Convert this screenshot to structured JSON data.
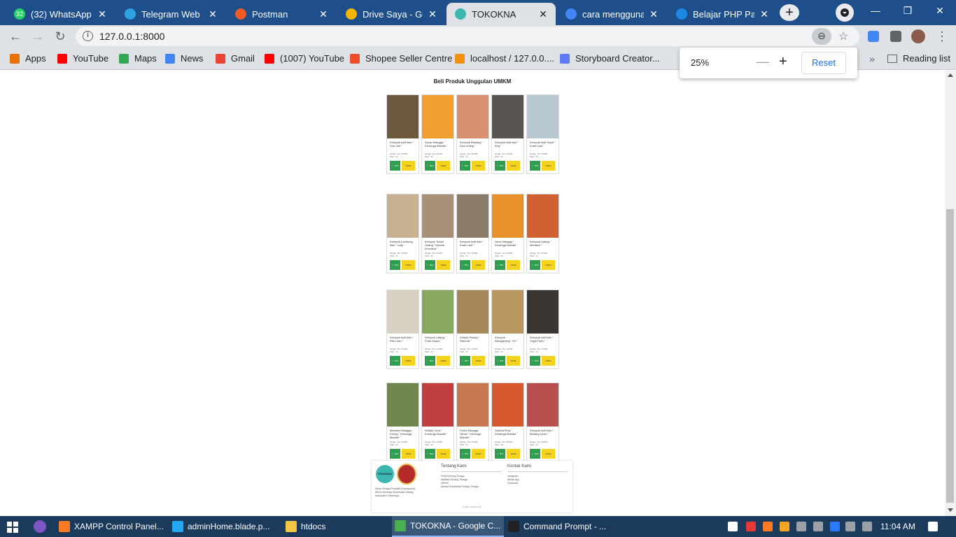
{
  "browser": {
    "tabs": [
      {
        "label": "(32) WhatsApp",
        "icon": "whatsapp-icon",
        "badge": "32",
        "color": "#25d366",
        "active": false
      },
      {
        "label": "Telegram Web",
        "icon": "telegram-icon",
        "color": "#2aa3df",
        "active": false
      },
      {
        "label": "Postman",
        "icon": "postman-icon",
        "color": "#ef5b25",
        "active": false
      },
      {
        "label": "Drive Saya - Goog",
        "icon": "drive-icon",
        "color": "#f4b400",
        "active": false
      },
      {
        "label": "TOKOKNA",
        "icon": "tokokna-icon",
        "color": "#3bb6b0",
        "active": true
      },
      {
        "label": "cara menggunaka",
        "icon": "google-icon",
        "color": "#4285f4",
        "active": false
      },
      {
        "label": "Belajar PHP Part",
        "icon": "dicoding-icon",
        "color": "#1e88e5",
        "active": false
      }
    ],
    "url": "127.0.0.1:8000",
    "bookmarks": [
      {
        "label": "Apps",
        "icon": "apps-grid-icon",
        "color": "#e8710a"
      },
      {
        "label": "YouTube",
        "icon": "youtube-icon",
        "color": "#ff0000"
      },
      {
        "label": "Maps",
        "icon": "maps-icon",
        "color": "#34a853"
      },
      {
        "label": "News",
        "icon": "news-icon",
        "color": "#4285f4"
      },
      {
        "label": "Gmail",
        "icon": "gmail-icon",
        "color": "#ea4335"
      },
      {
        "label": "(1007) YouTube",
        "icon": "youtube-icon",
        "color": "#ff0000"
      },
      {
        "label": "Shopee Seller Centre",
        "icon": "shopee-icon",
        "color": "#ee4d2d"
      },
      {
        "label": "localhost / 127.0.0....",
        "icon": "phpmyadmin-icon",
        "color": "#f29111"
      },
      {
        "label": "Storyboard Creator...",
        "icon": "storyboard-icon",
        "color": "#5c7cfa"
      }
    ],
    "reading_list": "Reading list",
    "zoom_popup": {
      "value": "25%",
      "minus": "—",
      "plus": "+",
      "reset": "Reset"
    }
  },
  "page": {
    "section_title": "Beli Produk Unggulan UMKM",
    "buy_label": "Beli",
    "detail_label": "Detail",
    "products": [
      [
        {
          "name": "Kerupuk kulit ikan \" Dua Jari \"",
          "price": "Harga : Rp. 10.000",
          "stock": "Stok : 21",
          "img": "#6d5a3e"
        },
        {
          "name": "Syrup Mangga \" Kenanga Mandiri \"",
          "price": "Harga : Rp. 25.000",
          "stock": "Stok : 21",
          "img": "#f0a030"
        },
        {
          "name": "Kerupuk Bawang \" Dua Udang \"",
          "price": "Harga : Rp. 15.000",
          "stock": "Stok : 21",
          "img": "#d89070"
        },
        {
          "name": "Kerupuk kulit ikan \" Indy \"",
          "price": "Harga : Rp. 10.000",
          "stock": "Stok : 21",
          "img": "#5a5550"
        },
        {
          "name": "Kerupuk kulit Gapit \" Kuda Laut \"",
          "price": "Harga : Rp. 10.000",
          "stock": "Stok : 26",
          "img": "#b8c8d0"
        }
      ],
      [
        {
          "name": "Kerupuk Lambung Ikan \" Indy \"",
          "price": "Harga : Rp. 10.000",
          "stock": "Stok : 21",
          "img": "#c8b090"
        },
        {
          "name": "Kerupuk Terasi Udang \" Mereta Kencana \"",
          "price": "Harga : Rp. 10.000",
          "stock": "Stok : 21",
          "img": "#a89078"
        },
        {
          "name": "Kerupuk kulit ikan \" Kuda Laut \"",
          "price": "Harga : Rp. 10.000",
          "stock": "Stok : 21",
          "img": "#8a7a68"
        },
        {
          "name": "Juice Mangga \" Kenanga Mandiri \"",
          "price": "Harga : Rp. 10.000",
          "stock": "Stok : 21",
          "img": "#e8902a"
        },
        {
          "name": "Kerupuk Udang \" Mentara \"",
          "price": "Harga : Rp. 15.000",
          "stock": "Stok : 21",
          "img": "#d06030"
        }
      ],
      [
        {
          "name": "Kerupuk kulit ikan \" Pita Laku \"",
          "price": "Harga : Rp. 10.000",
          "stock": "Stok : 21",
          "img": "#d8d0c0"
        },
        {
          "name": "Kerupuk Udang \" Putut Anjani \"",
          "price": "Harga : Rp. 10.000",
          "stock": "Stok : 21",
          "img": "#88a860"
        },
        {
          "name": "Keripik Pisang \" Rahmat \"",
          "price": "Harga : Rp. 10.000",
          "stock": "Stok : 21",
          "img": "#a88858"
        },
        {
          "name": "Kerupuk Rangginang \" Rz \"",
          "price": "Harga : Rp. 10.000",
          "stock": "Stok : 21",
          "img": "#b89860"
        },
        {
          "name": "Kerupuk kulit ikan \" Yoga Putra \"",
          "price": "Harga : Rp. 10.000",
          "stock": "Stok : 21",
          "img": "#3a3530"
        }
      ],
      [
        {
          "name": "Manisan Mangga Kering \" Kenanga Mandiri \"",
          "price": "Harga : Rp. 10.000",
          "stock": "Stok : 21",
          "img": "#708850"
        },
        {
          "name": "Keripik Usus \" Kenanga Mandiri \"",
          "price": "Harga : Rp. 10.000",
          "stock": "Stok : 21",
          "img": "#c04040"
        },
        {
          "name": "Dodol Mangga Slices \" Kenanga Mandiri \"",
          "price": "Harga : Rp. 20.000",
          "stock": "Stok : 21",
          "img": "#c87850"
        },
        {
          "name": "Sambal Roa \" Kenanga Mandiri \"",
          "price": "Harga : Rp. 25.000",
          "stock": "Stok : 29",
          "img": "#d85830"
        },
        {
          "name": "Kerupuk kulit ikan \" Bintang Ulum \"",
          "price": "Harga : Rp. 10.000",
          "stock": "Stok : 21",
          "img": "#b85050"
        }
      ]
    ],
    "footer": {
      "logo_text": "TOKOKNA",
      "desc": "Dinas Tenaga Produktif (Disnakprod) Dinas Kenanga Kecamatan Sidang Kabupaten Indramayu",
      "tentang_title": "Tentang Kami",
      "tentang_links": [
        "Profil Kenang Tenaga",
        "Aktifitas Kenang Tenaga",
        "UMKM",
        "Alamat Sekretariat Tenang Tenaga"
      ],
      "kontak_title": "Kontak Kami",
      "kontak_links": [
        "Instagram",
        "Whats App",
        "Facebook"
      ],
      "copyright": "© 2021 Tokokna Tim"
    }
  },
  "taskbar": {
    "items": [
      {
        "label": "XAMPP Control Panel...",
        "icon": "xampp-icon",
        "color": "#fb7a24"
      },
      {
        "label": "adminHome.blade.p...",
        "icon": "vscode-icon",
        "color": "#23a9f2"
      },
      {
        "label": "htdocs",
        "icon": "folder-icon",
        "color": "#f6c744"
      },
      {
        "label": "TOKOKNA - Google C...",
        "icon": "chrome-icon",
        "color": "#4caf50"
      },
      {
        "label": "Command Prompt - ...",
        "icon": "cmd-icon",
        "color": "#222"
      }
    ],
    "time": "11:04 AM"
  }
}
